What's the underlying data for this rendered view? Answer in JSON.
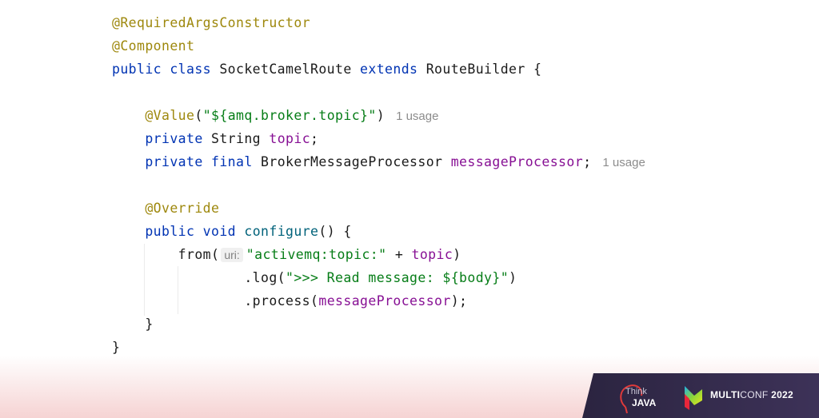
{
  "editor": {
    "lines": [
      {
        "tokens": [
          {
            "t": "@RequiredArgsConstructor",
            "c": "ann"
          }
        ]
      },
      {
        "tokens": [
          {
            "t": "@Component",
            "c": "ann"
          }
        ]
      },
      {
        "tokens": [
          {
            "t": "public class ",
            "c": "kw"
          },
          {
            "t": "SocketCamelRoute ",
            "c": ""
          },
          {
            "t": "extends ",
            "c": "kw"
          },
          {
            "t": "RouteBuilder {",
            "c": ""
          }
        ]
      },
      {
        "tokens": []
      },
      {
        "tokens": [
          {
            "t": "    ",
            "c": ""
          },
          {
            "t": "@Value",
            "c": "ann"
          },
          {
            "t": "(",
            "c": ""
          },
          {
            "t": "\"${amq.broker.topic}\"",
            "c": "str"
          },
          {
            "t": ")",
            "c": ""
          }
        ],
        "hint": "1 usage"
      },
      {
        "tokens": [
          {
            "t": "    ",
            "c": ""
          },
          {
            "t": "private ",
            "c": "kw"
          },
          {
            "t": "String ",
            "c": ""
          },
          {
            "t": "topic",
            "c": "fld"
          },
          {
            "t": ";",
            "c": ""
          }
        ]
      },
      {
        "tokens": [
          {
            "t": "    ",
            "c": ""
          },
          {
            "t": "private final ",
            "c": "kw"
          },
          {
            "t": "BrokerMessageProcessor ",
            "c": ""
          },
          {
            "t": "messageProcessor",
            "c": "fld"
          },
          {
            "t": ";",
            "c": ""
          }
        ],
        "hint": "1 usage"
      },
      {
        "tokens": []
      },
      {
        "tokens": [
          {
            "t": "    ",
            "c": ""
          },
          {
            "t": "@Override",
            "c": "ann"
          }
        ]
      },
      {
        "tokens": [
          {
            "t": "    ",
            "c": ""
          },
          {
            "t": "public void ",
            "c": "kw"
          },
          {
            "t": "configure",
            "c": "mth"
          },
          {
            "t": "() {",
            "c": ""
          }
        ]
      },
      {
        "tokens": [
          {
            "t": "        from(",
            "c": ""
          },
          {
            "t": "uri:",
            "c": "inlay"
          },
          {
            "t": "\"activemq:topic:\"",
            "c": "str"
          },
          {
            "t": " + ",
            "c": ""
          },
          {
            "t": "topic",
            "c": "fld"
          },
          {
            "t": ")",
            "c": ""
          }
        ]
      },
      {
        "tokens": [
          {
            "t": "                .log(",
            "c": ""
          },
          {
            "t": "\">>> Read message: ${body}\"",
            "c": "str"
          },
          {
            "t": ")",
            "c": ""
          }
        ]
      },
      {
        "tokens": [
          {
            "t": "                .process(",
            "c": ""
          },
          {
            "t": "messageProcessor",
            "c": "fld"
          },
          {
            "t": ");",
            "c": ""
          }
        ]
      },
      {
        "tokens": [
          {
            "t": "    }",
            "c": ""
          }
        ]
      },
      {
        "tokens": [
          {
            "t": "}",
            "c": ""
          }
        ]
      }
    ]
  },
  "footer": {
    "think_label": "Think",
    "java_label": "JAVA",
    "multi_bold": "MULTI",
    "multi_light": "CONF",
    "year": "2022"
  }
}
